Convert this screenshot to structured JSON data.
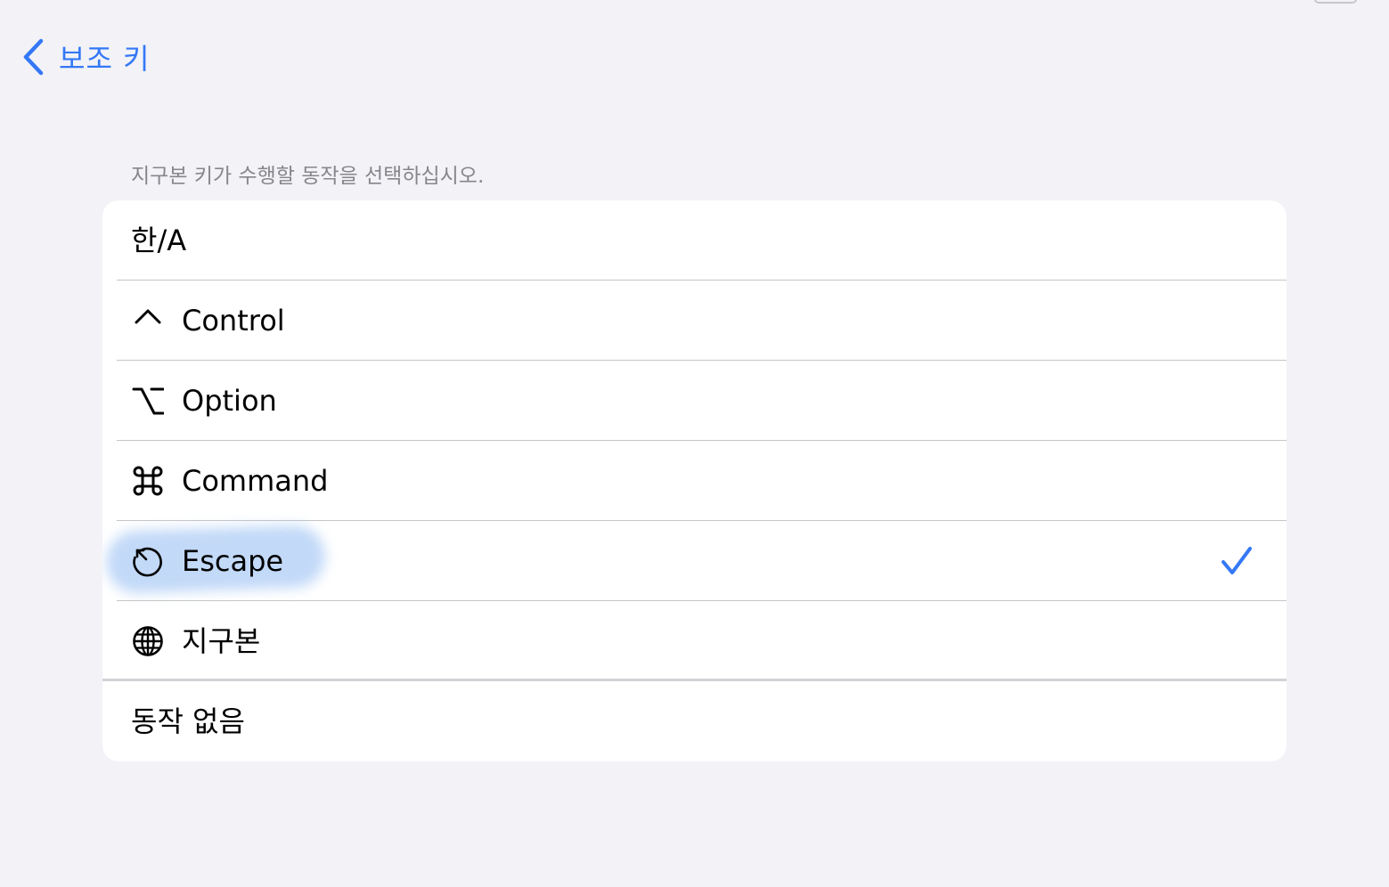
{
  "nav": {
    "back_label": "보조 키"
  },
  "section": {
    "header": "지구본 키가 수행할 동작을 선택하십시오."
  },
  "options": [
    {
      "label": "한/A",
      "icon": "none",
      "selected": false
    },
    {
      "label": "Control",
      "icon": "control-caret-icon",
      "selected": false
    },
    {
      "label": "Option",
      "icon": "option-key-icon",
      "selected": false
    },
    {
      "label": "Command",
      "icon": "command-key-icon",
      "selected": false
    },
    {
      "label": "Escape",
      "icon": "escape-key-icon",
      "selected": true
    },
    {
      "label": "지구본",
      "icon": "globe-icon",
      "selected": false
    },
    {
      "label": "동작 없음",
      "icon": "none",
      "selected": false
    }
  ],
  "colors": {
    "accent": "#3478f6",
    "background": "#f2f2f7",
    "group_background": "#ffffff",
    "section_header": "#86868b",
    "separator": "#c6c6c8",
    "highlight": "#78aaf0"
  }
}
